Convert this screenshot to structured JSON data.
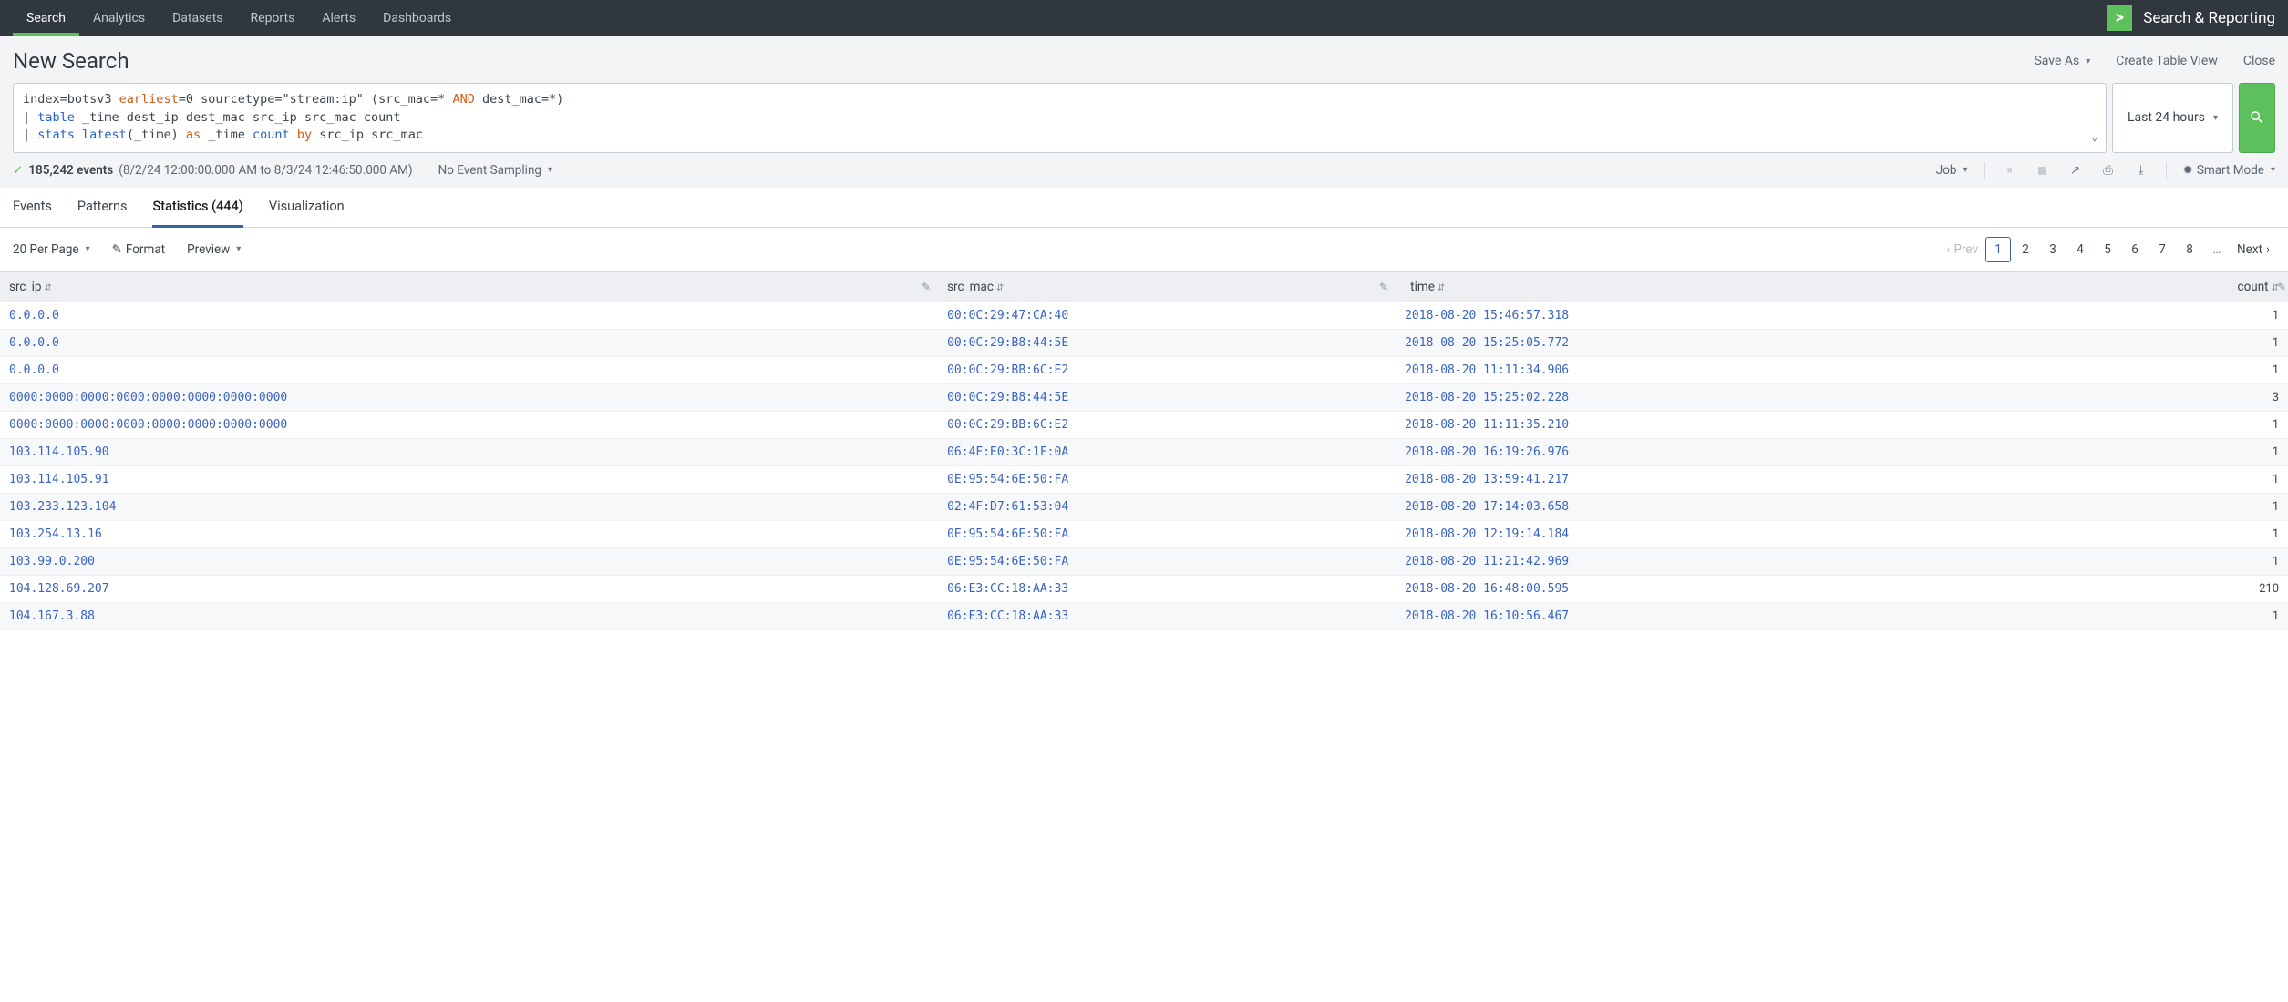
{
  "topnav": {
    "items": [
      "Search",
      "Analytics",
      "Datasets",
      "Reports",
      "Alerts",
      "Dashboards"
    ],
    "active": 0,
    "app_title": "Search & Reporting"
  },
  "header": {
    "title": "New Search",
    "actions": {
      "save_as": "Save As",
      "create_table": "Create Table View",
      "close": "Close"
    }
  },
  "search": {
    "line1_pre": "index=botsv3 ",
    "line1_kw1": "earliest",
    "line1_mid": "=0 sourcetype=\"stream:ip\" (src_mac=* ",
    "line1_kw2": "AND",
    "line1_post": " dest_mac=*)",
    "line2_pipe": "| ",
    "line2_kw": "table",
    "line2_rest": " _time dest_ip dest_mac src_ip src_mac count",
    "line3_pipe": "| ",
    "line3_kw1": "stats",
    "line3_mid1": " ",
    "line3_kw2": "latest",
    "line3_mid2": "(_time) ",
    "line3_kw3": "as",
    "line3_mid3": " _time ",
    "line3_kw4": "count",
    "line3_mid4": " ",
    "line3_kw5": "by",
    "line3_rest": " src_ip src_mac",
    "time_label": "Last 24 hours"
  },
  "status": {
    "events_count": "185,242 events",
    "events_range": "(8/2/24 12:00:00.000 AM to 8/3/24 12:46:50.000 AM)",
    "sampling": "No Event Sampling",
    "job": "Job",
    "smart_mode": "Smart Mode"
  },
  "tabs": {
    "events": "Events",
    "patterns": "Patterns",
    "statistics": "Statistics (444)",
    "visualization": "Visualization"
  },
  "toolbar": {
    "per_page": "20 Per Page",
    "format": "Format",
    "preview": "Preview",
    "prev": "Prev",
    "next": "Next",
    "pages": [
      "1",
      "2",
      "3",
      "4",
      "5",
      "6",
      "7",
      "8"
    ]
  },
  "table": {
    "columns": {
      "src_ip": "src_ip",
      "src_mac": "src_mac",
      "time": "_time",
      "count": "count"
    },
    "rows": [
      {
        "src_ip": "0.0.0.0",
        "src_mac": "00:0C:29:47:CA:40",
        "time": "2018-08-20 15:46:57.318",
        "count": "1"
      },
      {
        "src_ip": "0.0.0.0",
        "src_mac": "00:0C:29:B8:44:5E",
        "time": "2018-08-20 15:25:05.772",
        "count": "1"
      },
      {
        "src_ip": "0.0.0.0",
        "src_mac": "00:0C:29:BB:6C:E2",
        "time": "2018-08-20 11:11:34.906",
        "count": "1"
      },
      {
        "src_ip": "0000:0000:0000:0000:0000:0000:0000:0000",
        "src_mac": "00:0C:29:B8:44:5E",
        "time": "2018-08-20 15:25:02.228",
        "count": "3"
      },
      {
        "src_ip": "0000:0000:0000:0000:0000:0000:0000:0000",
        "src_mac": "00:0C:29:BB:6C:E2",
        "time": "2018-08-20 11:11:35.210",
        "count": "1"
      },
      {
        "src_ip": "103.114.105.90",
        "src_mac": "06:4F:E0:3C:1F:0A",
        "time": "2018-08-20 16:19:26.976",
        "count": "1"
      },
      {
        "src_ip": "103.114.105.91",
        "src_mac": "0E:95:54:6E:50:FA",
        "time": "2018-08-20 13:59:41.217",
        "count": "1"
      },
      {
        "src_ip": "103.233.123.104",
        "src_mac": "02:4F:D7:61:53:04",
        "time": "2018-08-20 17:14:03.658",
        "count": "1"
      },
      {
        "src_ip": "103.254.13.16",
        "src_mac": "0E:95:54:6E:50:FA",
        "time": "2018-08-20 12:19:14.184",
        "count": "1"
      },
      {
        "src_ip": "103.99.0.200",
        "src_mac": "0E:95:54:6E:50:FA",
        "time": "2018-08-20 11:21:42.969",
        "count": "1"
      },
      {
        "src_ip": "104.128.69.207",
        "src_mac": "06:E3:CC:18:AA:33",
        "time": "2018-08-20 16:48:00.595",
        "count": "210"
      },
      {
        "src_ip": "104.167.3.88",
        "src_mac": "06:E3:CC:18:AA:33",
        "time": "2018-08-20 16:10:56.467",
        "count": "1"
      }
    ]
  }
}
